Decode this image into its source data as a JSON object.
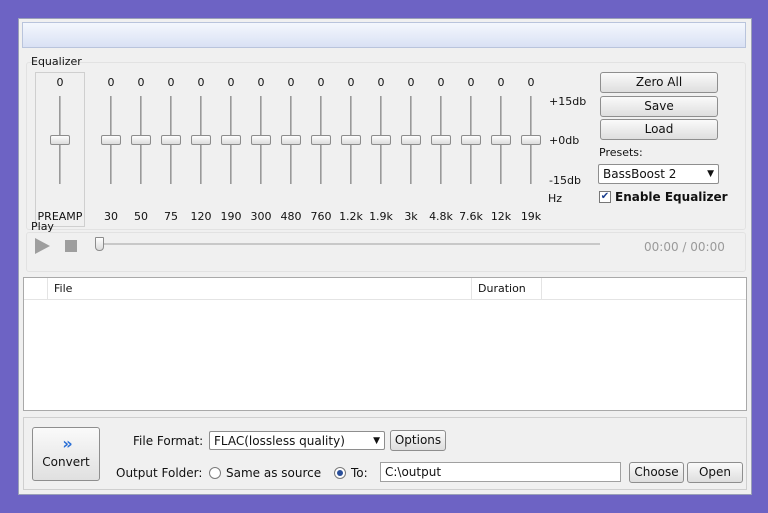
{
  "equalizer": {
    "label": "Equalizer",
    "preamp": {
      "value": "0",
      "label": "PREAMP",
      "level": 0
    },
    "bands": [
      {
        "value": "0",
        "freq": "30"
      },
      {
        "value": "0",
        "freq": "50"
      },
      {
        "value": "0",
        "freq": "75"
      },
      {
        "value": "0",
        "freq": "120"
      },
      {
        "value": "0",
        "freq": "190"
      },
      {
        "value": "0",
        "freq": "300"
      },
      {
        "value": "0",
        "freq": "480"
      },
      {
        "value": "0",
        "freq": "760"
      },
      {
        "value": "0",
        "freq": "1.2k"
      },
      {
        "value": "0",
        "freq": "1.9k"
      },
      {
        "value": "0",
        "freq": "3k"
      },
      {
        "value": "0",
        "freq": "4.8k"
      },
      {
        "value": "0",
        "freq": "7.6k"
      },
      {
        "value": "0",
        "freq": "12k"
      },
      {
        "value": "0",
        "freq": "19k"
      }
    ],
    "hz_label": "Hz",
    "db_labels": {
      "top": "+15db",
      "mid": "+0db",
      "bottom": "-15db"
    },
    "zero_all": "Zero All",
    "save": "Save",
    "load": "Load",
    "presets_label": "Presets:",
    "preset_selected": "BassBoost 2",
    "enable_label": "Enable Equalizer",
    "enable_checked": true
  },
  "play": {
    "label": "Play",
    "time": "00:00 / 00:00",
    "progress": 0
  },
  "file_list": {
    "columns": [
      "File",
      "Duration"
    ]
  },
  "bottom": {
    "convert_label": "Convert",
    "convert_icon": "double-chevron-right-icon",
    "file_format_label": "File Format:",
    "file_format_value": "FLAC(lossless quality)",
    "options_label": "Options",
    "output_folder_label": "Output Folder:",
    "same_as_source_label": "Same as source",
    "to_label": "To:",
    "output_path": "C:\\output",
    "choose_label": "Choose",
    "open_label": "Open",
    "selected_output": "to"
  },
  "colors": {
    "background": "#6d63c4",
    "accent": "#2a6fd6"
  }
}
